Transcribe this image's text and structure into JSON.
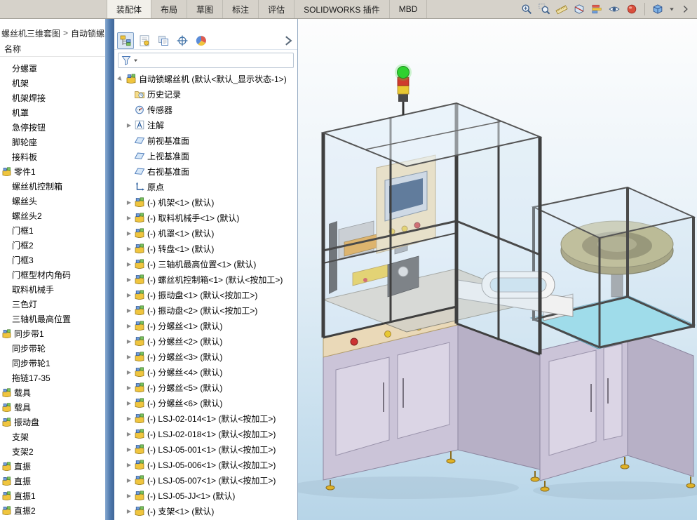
{
  "ribbon": {
    "tabs": [
      {
        "label": "装配体",
        "active": true
      },
      {
        "label": "布局",
        "active": false
      },
      {
        "label": "草图",
        "active": false
      },
      {
        "label": "标注",
        "active": false
      },
      {
        "label": "评估",
        "active": false
      },
      {
        "label": "SOLIDWORKS 插件",
        "active": false
      },
      {
        "label": "MBD",
        "active": false
      }
    ],
    "view_toolbar_icons": [
      "zoom-to-fit-icon",
      "zoom-to-area-icon",
      "measure-icon",
      "section-view-icon",
      "assembly-visualization-icon",
      "hide-show-icon",
      "appearance-icon"
    ],
    "right_icons": [
      "display-style-icon",
      "dropdown-caret-icon",
      "expand-toolbar-icon"
    ]
  },
  "left_panel": {
    "breadcrumb": {
      "items": [
        "螺丝机三维套图",
        "自动锁螺丝机"
      ],
      "separator": ">"
    },
    "header": "名称",
    "items": [
      {
        "label": "分螺罩",
        "type": "part"
      },
      {
        "label": "机架",
        "type": "part"
      },
      {
        "label": "机架焊接",
        "type": "part"
      },
      {
        "label": "机罩",
        "type": "part"
      },
      {
        "label": "急停按钮",
        "type": "part"
      },
      {
        "label": "脚轮座",
        "type": "part"
      },
      {
        "label": "接料板",
        "type": "part"
      },
      {
        "label": "零件1",
        "type": "assembly"
      },
      {
        "label": "螺丝机控制箱",
        "type": "part"
      },
      {
        "label": "螺丝头",
        "type": "part"
      },
      {
        "label": "螺丝头2",
        "type": "part"
      },
      {
        "label": "门框1",
        "type": "part"
      },
      {
        "label": "门框2",
        "type": "part"
      },
      {
        "label": "门框3",
        "type": "part"
      },
      {
        "label": "门框型材内角码",
        "type": "part"
      },
      {
        "label": "取料机械手",
        "type": "part"
      },
      {
        "label": "三色灯",
        "type": "part"
      },
      {
        "label": "三轴机最高位置",
        "type": "part"
      },
      {
        "label": "同步带1",
        "type": "assembly"
      },
      {
        "label": "同步带轮",
        "type": "part"
      },
      {
        "label": "同步带轮1",
        "type": "part"
      },
      {
        "label": "拖链17-35",
        "type": "part"
      },
      {
        "label": "载具",
        "type": "assembly"
      },
      {
        "label": "载具",
        "type": "assembly"
      },
      {
        "label": "振动盘",
        "type": "assembly"
      },
      {
        "label": "支架",
        "type": "part"
      },
      {
        "label": "支架2",
        "type": "part"
      },
      {
        "label": "直振",
        "type": "assembly"
      },
      {
        "label": "直振",
        "type": "assembly"
      },
      {
        "label": "直振1",
        "type": "assembly"
      },
      {
        "label": "直振2",
        "type": "assembly"
      }
    ]
  },
  "feature_panel": {
    "tabs": [
      {
        "icon": "featuremanager-tab-icon",
        "active": true
      },
      {
        "icon": "propertymanager-tab-icon",
        "active": false
      },
      {
        "icon": "configurationmanager-tab-icon",
        "active": false
      },
      {
        "icon": "dimxpert-tab-icon",
        "active": false
      },
      {
        "icon": "displaymanager-tab-icon",
        "active": false
      }
    ],
    "filter_value": "",
    "tree": {
      "root": {
        "icon": "assembly-icon",
        "label": "自动锁螺丝机 (默认<默认_显示状态-1>)",
        "expand": "expanded"
      },
      "items": [
        {
          "icon": "history-icon",
          "label": "历史记录",
          "expand": "none"
        },
        {
          "icon": "sensors-icon",
          "label": "传感器",
          "expand": "none"
        },
        {
          "icon": "annotations-icon",
          "label": "注解",
          "expand": "collapsed"
        },
        {
          "icon": "plane-icon",
          "label": "前视基准面",
          "expand": "none"
        },
        {
          "icon": "plane-icon",
          "label": "上视基准面",
          "expand": "none"
        },
        {
          "icon": "plane-icon",
          "label": "右视基准面",
          "expand": "none"
        },
        {
          "icon": "origin-icon",
          "label": "原点",
          "expand": "none"
        },
        {
          "icon": "component-icon",
          "label": "(-) 机架<1> (默认)",
          "expand": "collapsed"
        },
        {
          "icon": "component-icon",
          "label": "(-) 取料机械手<1> (默认)",
          "expand": "collapsed"
        },
        {
          "icon": "component-icon",
          "label": "(-) 机罩<1> (默认)",
          "expand": "collapsed"
        },
        {
          "icon": "component-icon",
          "label": "(-) 转盘<1> (默认)",
          "expand": "collapsed"
        },
        {
          "icon": "component-icon",
          "label": "(-) 三轴机最高位置<1> (默认)",
          "expand": "collapsed"
        },
        {
          "icon": "component-icon",
          "label": "(-) 螺丝机控制箱<1> (默认<按加工>)",
          "expand": "collapsed"
        },
        {
          "icon": "component-icon",
          "label": "(-) 振动盘<1> (默认<按加工>)",
          "expand": "collapsed"
        },
        {
          "icon": "component-icon",
          "label": "(-) 振动盘<2> (默认<按加工>)",
          "expand": "collapsed"
        },
        {
          "icon": "component-icon",
          "label": "(-) 分螺丝<1> (默认)",
          "expand": "collapsed"
        },
        {
          "icon": "component-icon",
          "label": "(-) 分螺丝<2> (默认)",
          "expand": "collapsed"
        },
        {
          "icon": "component-icon",
          "label": "(-) 分螺丝<3> (默认)",
          "expand": "collapsed"
        },
        {
          "icon": "component-icon",
          "label": "(-) 分螺丝<4> (默认)",
          "expand": "collapsed"
        },
        {
          "icon": "component-icon",
          "label": "(-) 分螺丝<5> (默认)",
          "expand": "collapsed"
        },
        {
          "icon": "component-icon",
          "label": "(-) 分螺丝<6> (默认)",
          "expand": "collapsed"
        },
        {
          "icon": "component-icon",
          "label": "(-) LSJ-02-014<1> (默认<按加工>)",
          "expand": "collapsed"
        },
        {
          "icon": "component-icon",
          "label": "(-) LSJ-02-018<1> (默认<按加工>)",
          "expand": "collapsed"
        },
        {
          "icon": "component-icon",
          "label": "(-) LSJ-05-001<1> (默认<按加工>)",
          "expand": "collapsed"
        },
        {
          "icon": "component-icon",
          "label": "(-) LSJ-05-006<1> (默认<按加工>)",
          "expand": "collapsed"
        },
        {
          "icon": "component-icon",
          "label": "(-) LSJ-05-007<1> (默认<按加工>)",
          "expand": "collapsed"
        },
        {
          "icon": "component-icon",
          "label": "(-) LSJ-05-JJ<1> (默认)",
          "expand": "collapsed"
        },
        {
          "icon": "component-icon",
          "label": "(-) 支架<1> (默认)",
          "expand": "collapsed"
        }
      ]
    }
  },
  "viewport": {
    "background_top": "#fdfdfd",
    "background_mid": "#e7f1f8",
    "background_bottom": "#b7d5e8",
    "tower_light_colors": [
      "#2fd22f",
      "#cf3b2d",
      "#e8c832"
    ],
    "machine_cabinet_color": "#cbc4d8",
    "bowl_feeder_color": "#b6ac72",
    "tabletop_color": "#9fdcea"
  }
}
